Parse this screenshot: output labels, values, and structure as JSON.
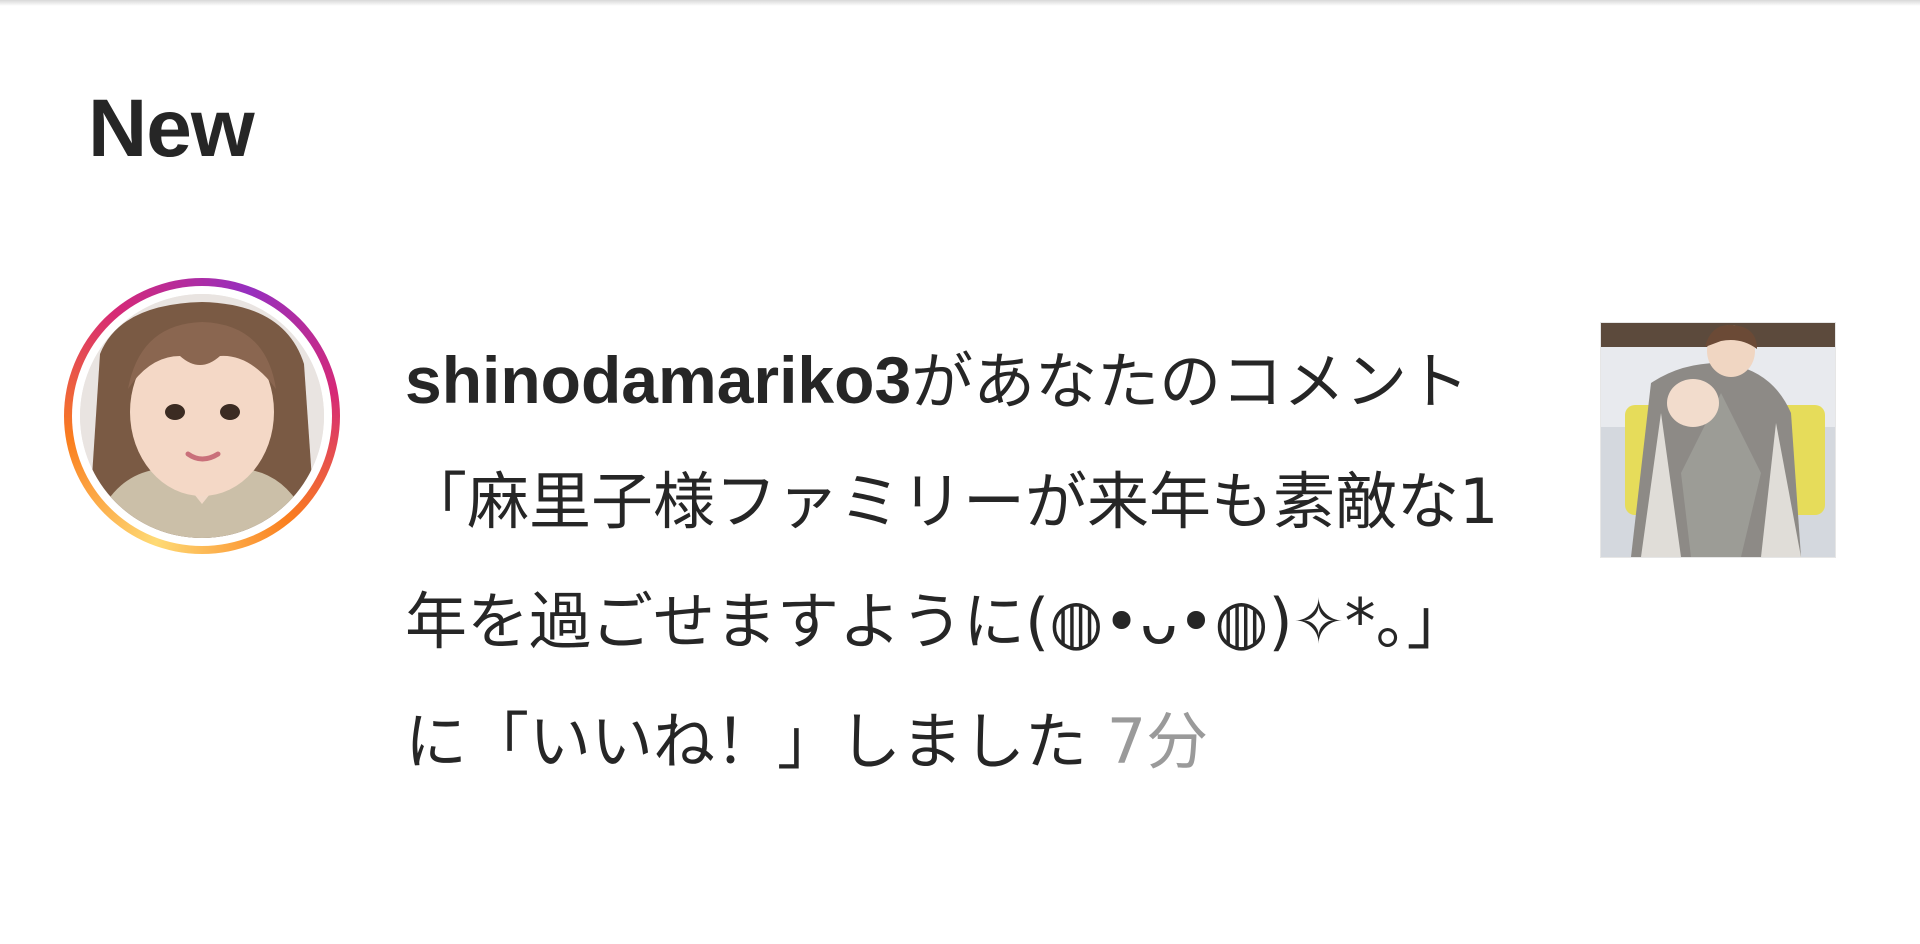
{
  "section": {
    "title": "New"
  },
  "notification": {
    "username": "shinodamariko3",
    "message": "があなたのコメント「麻里子様ファミリーが来年も素敵な1年を過ごせますように(◍•ᴗ•◍)✧*。」に「いいね！」しました",
    "time": "7分",
    "avatar_icon": "profile-photo",
    "thumbnail_icon": "post-photo"
  },
  "colors": {
    "text_primary": "#262626",
    "text_secondary": "#9a9a9a",
    "story_ring_start": "#feda75",
    "story_ring_end": "#962fbf"
  }
}
